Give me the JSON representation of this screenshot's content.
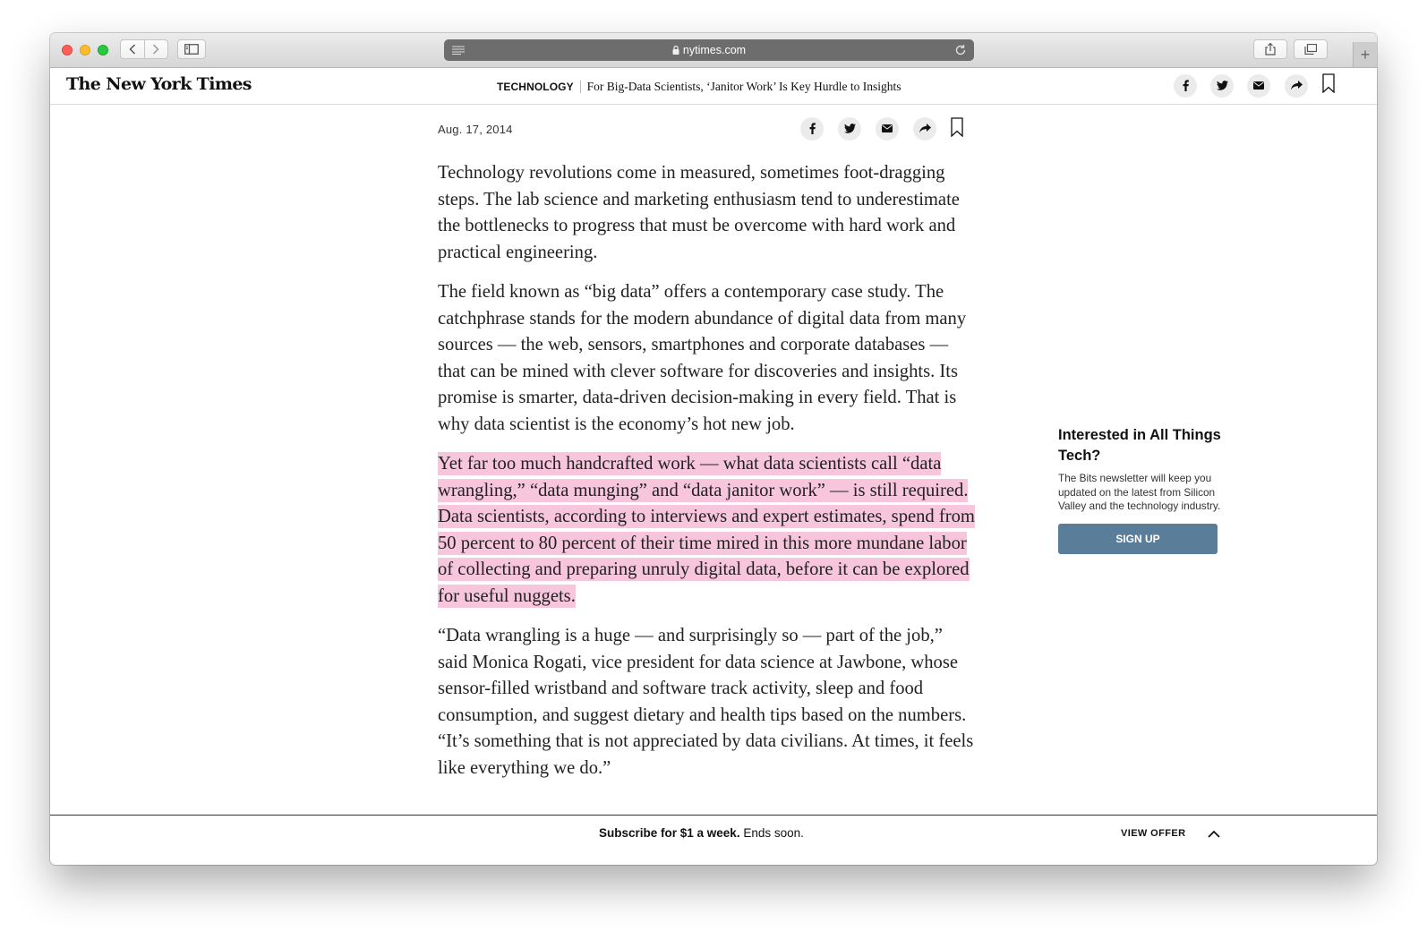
{
  "browser": {
    "url": "nytimes.com"
  },
  "nyt": {
    "logo": "The New York Times",
    "section": "TECHNOLOGY",
    "headline": "For Big-Data Scientists, ‘Janitor Work’ Is Key Hurdle to Insights"
  },
  "article": {
    "date": "Aug. 17, 2014",
    "paragraphs": [
      "Technology revolutions come in measured, sometimes foot-dragging steps. The lab science and marketing enthusiasm tend to underestimate the bottlenecks to progress that must be overcome with hard work and practical engineering.",
      "The field known as “big data” offers a contemporary case study. The catchphrase stands for the modern abundance of digital data from many sources — the web, sensors, smartphones and corporate databases — that can be mined with clever software for discoveries and insights. Its promise is smarter, data-driven decision-making in every field. That is why data scientist is the economy’s hot new job.",
      "Yet far too much handcrafted work — what data scientists call “data wrangling,” “data munging” and “data janitor work” — is still required. Data scientists, according to interviews and expert estimates, spend from 50 percent to 80 percent of their time mired in this more mundane labor of collecting and preparing unruly digital data, before it can be explored for useful nuggets.",
      "“Data wrangling is a huge — and surprisingly so — part of the job,” said Monica Rogati, vice president for data science at Jawbone, whose sensor-filled wristband and software track activity, sleep and food consumption, and suggest dietary and health tips based on the numbers. “It’s something that is not appreciated by data civilians. At times, it feels like everything we do.”"
    ],
    "highlight_color": "#f7c6dd"
  },
  "sidebar": {
    "title": "Interested in All Things Tech?",
    "text": "The Bits newsletter will keep you updated on the latest from Silicon Valley and the technology industry.",
    "button": "SIGN UP",
    "button_color": "#5a7d9a"
  },
  "subscribe": {
    "bold": "Subscribe for $1 a week.",
    "rest": " Ends soon.",
    "offer": "VIEW OFFER"
  },
  "icons": {
    "share": [
      "facebook-icon",
      "twitter-icon",
      "email-icon",
      "share-arrow-icon",
      "bookmark-icon"
    ]
  }
}
